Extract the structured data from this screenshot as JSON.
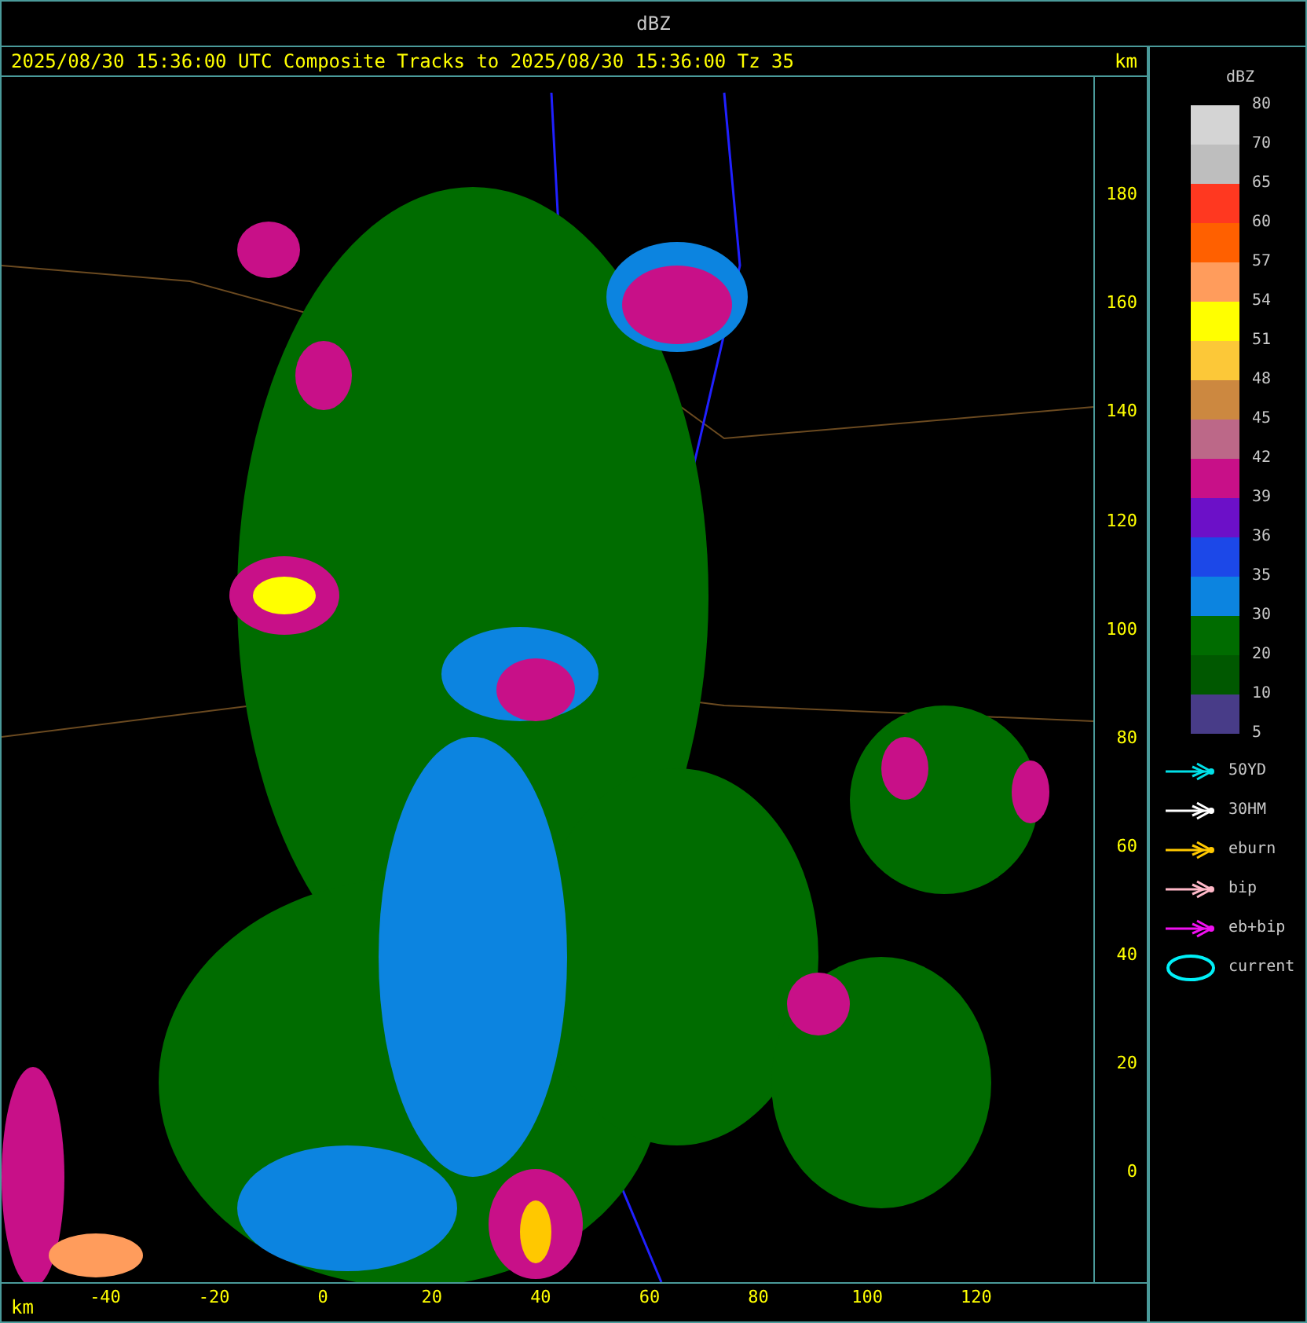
{
  "window": {
    "title": "dBZ"
  },
  "header": {
    "caption": "2025/08/30 15:36:00 UTC Composite Tracks to 2025/08/30 15:36:00 Tz 35",
    "unit": "km"
  },
  "y_axis": {
    "ticks": [
      "180",
      "160",
      "140",
      "120",
      "100",
      "80",
      "60",
      "40",
      "20",
      "0"
    ]
  },
  "x_axis": {
    "unit": "km",
    "ticks": [
      "-40",
      "-20",
      "0",
      "20",
      "40",
      "60",
      "80",
      "100",
      "120"
    ]
  },
  "legend": {
    "title": "dBZ",
    "labels": [
      "80",
      "70",
      "65",
      "60",
      "57",
      "54",
      "51",
      "48",
      "45",
      "42",
      "39",
      "36",
      "35",
      "30",
      "20",
      "10",
      "5"
    ],
    "swatches": [
      {
        "color": "#d4d4d4"
      },
      {
        "color": "#bebebe"
      },
      {
        "color": "#ff3820"
      },
      {
        "color": "#ff6000"
      },
      {
        "color": "#ff9c5c"
      },
      {
        "color": "#ffff00"
      },
      {
        "color": "#fcc838"
      },
      {
        "color": "#cc8840"
      },
      {
        "color": "#bc6888"
      },
      {
        "color": "#c81088"
      },
      {
        "color": "#6c10c8"
      },
      {
        "color": "#1c48e8"
      },
      {
        "color": "#0c84e0"
      },
      {
        "color": "#006c00"
      },
      {
        "color": "#005800"
      },
      {
        "color": "#483c88"
      }
    ],
    "tracks": [
      {
        "kind": "arrow",
        "label": "50YD",
        "color": "#00e0e8"
      },
      {
        "kind": "arrow",
        "label": "30HM",
        "color": "#ffffff"
      },
      {
        "kind": "arrow",
        "label": "eburn",
        "color": "#ffc800"
      },
      {
        "kind": "arrow",
        "label": "bip",
        "color": "#ffb8c8"
      },
      {
        "kind": "arrow",
        "label": "eb+bip",
        "color": "#f010f0"
      },
      {
        "kind": "ellipse",
        "label": "current",
        "color": "#00f0f8"
      }
    ]
  }
}
